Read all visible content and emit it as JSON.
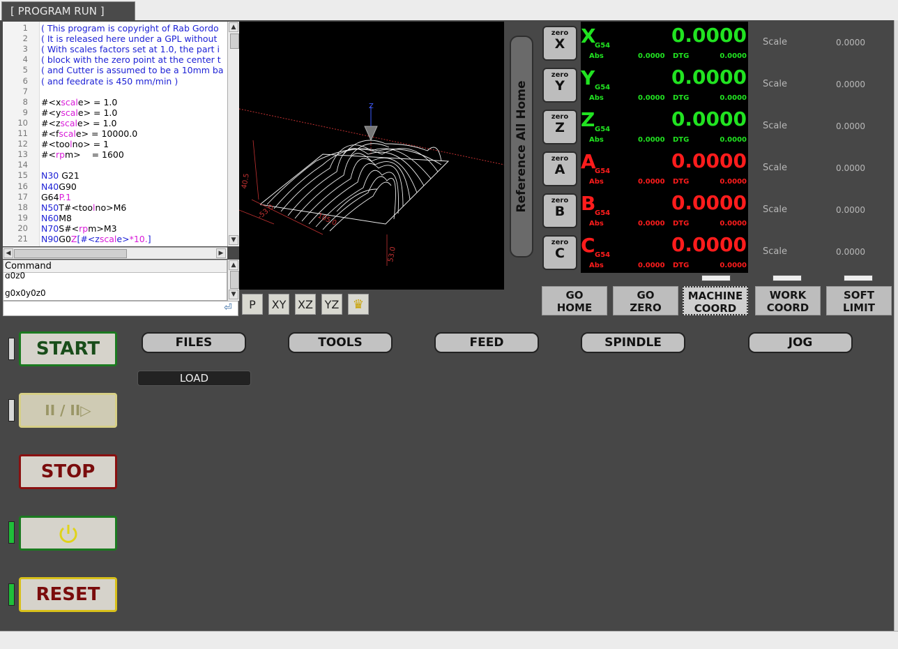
{
  "tab": {
    "label": "[ PROGRAM RUN ]"
  },
  "gcode": {
    "lines": [
      {
        "n": "1",
        "parts": [
          [
            "cm",
            "( This program is copyright of Rab Gordo"
          ]
        ]
      },
      {
        "n": "2",
        "parts": [
          [
            "cm",
            "( It is released here under a GPL without"
          ]
        ]
      },
      {
        "n": "3",
        "parts": [
          [
            "cm",
            "( With scales factors set at 1.0, the part i"
          ]
        ]
      },
      {
        "n": "4",
        "parts": [
          [
            "cm",
            "( block with the zero point at the center t"
          ]
        ]
      },
      {
        "n": "5",
        "parts": [
          [
            "cm",
            "( and Cutter is assumed to be a 10mm ba"
          ]
        ]
      },
      {
        "n": "6",
        "parts": [
          [
            "cm",
            "( and feedrate is 450 mm/min )"
          ]
        ]
      },
      {
        "n": "7",
        "parts": []
      },
      {
        "n": "8",
        "parts": [
          [
            "tx",
            "#<x"
          ],
          [
            "vr",
            "scal"
          ],
          [
            "tx",
            "e> = 1.0"
          ]
        ]
      },
      {
        "n": "9",
        "parts": [
          [
            "tx",
            "#<y"
          ],
          [
            "vr",
            "scal"
          ],
          [
            "tx",
            "e> = 1.0"
          ]
        ]
      },
      {
        "n": "10",
        "parts": [
          [
            "tx",
            "#<z"
          ],
          [
            "vr",
            "scal"
          ],
          [
            "tx",
            "e> = 1.0"
          ]
        ]
      },
      {
        "n": "11",
        "parts": [
          [
            "tx",
            "#<f"
          ],
          [
            "vr",
            "scal"
          ],
          [
            "tx",
            "e> = 10000.0"
          ]
        ]
      },
      {
        "n": "12",
        "parts": [
          [
            "tx",
            "#<too"
          ],
          [
            "vr",
            "l"
          ],
          [
            "tx",
            "no> = 1"
          ]
        ]
      },
      {
        "n": "13",
        "parts": [
          [
            "tx",
            "#<"
          ],
          [
            "vr",
            "rp"
          ],
          [
            "tx",
            "m>    = 1600"
          ]
        ]
      },
      {
        "n": "14",
        "parts": []
      },
      {
        "n": "15",
        "parts": [
          [
            "nb",
            "N30"
          ],
          [
            "tx",
            " G21"
          ]
        ]
      },
      {
        "n": "16",
        "parts": [
          [
            "nb",
            "N40"
          ],
          [
            "tx",
            "G90"
          ]
        ]
      },
      {
        "n": "17",
        "parts": [
          [
            "tx",
            "G64"
          ],
          [
            "pm",
            "P.1"
          ]
        ]
      },
      {
        "n": "18",
        "parts": [
          [
            "nb",
            "N50"
          ],
          [
            "tx",
            "T#<too"
          ],
          [
            "vr",
            "l"
          ],
          [
            "tx",
            "no>M6"
          ]
        ]
      },
      {
        "n": "19",
        "parts": [
          [
            "nb",
            "N60"
          ],
          [
            "tx",
            "M8"
          ]
        ]
      },
      {
        "n": "20",
        "parts": [
          [
            "nb",
            "N70"
          ],
          [
            "tx",
            "S#<"
          ],
          [
            "vr",
            "rp"
          ],
          [
            "tx",
            "m>M3"
          ]
        ]
      },
      {
        "n": "21",
        "parts": [
          [
            "nb",
            "N90"
          ],
          [
            "tx",
            "G0"
          ],
          [
            "pm",
            "Z"
          ],
          [
            "nb",
            "[#<z"
          ],
          [
            "vr",
            "scal"
          ],
          [
            "nb",
            "e>"
          ],
          [
            "pm",
            "*10."
          ],
          [
            "nb",
            "]"
          ]
        ]
      }
    ]
  },
  "command": {
    "header": "Command",
    "history": [
      "g0z0",
      "g0x0y0z0"
    ],
    "input_value": ""
  },
  "preview": {
    "view_buttons": [
      "P",
      "XY",
      "XZ",
      "YZ"
    ],
    "dims": {
      "x": "105.0",
      "y": "40.5",
      "y2": "16.5",
      "neg": "-53.0",
      "z": "53.0",
      "neg2": "-56"
    },
    "axis_label": "Z"
  },
  "reference_all_home": "Reference All Home",
  "zero_label": "zero",
  "axes": [
    {
      "axis": "X",
      "system": "G54",
      "value": "0.0000",
      "abs_label": "Abs",
      "abs": "0.0000",
      "dtg_label": "DTG",
      "dtg": "0.0000",
      "color": "#21e321",
      "scale_label": "Scale",
      "scale": "0.0000"
    },
    {
      "axis": "Y",
      "system": "G54",
      "value": "0.0000",
      "abs_label": "Abs",
      "abs": "0.0000",
      "dtg_label": "DTG",
      "dtg": "0.0000",
      "color": "#21e321",
      "scale_label": "Scale",
      "scale": "0.0000"
    },
    {
      "axis": "Z",
      "system": "G54",
      "value": "0.0000",
      "abs_label": "Abs",
      "abs": "0.0000",
      "dtg_label": "DTG",
      "dtg": "0.0000",
      "color": "#21e321",
      "scale_label": "Scale",
      "scale": "0.0000"
    },
    {
      "axis": "A",
      "system": "G54",
      "value": "0.0000",
      "abs_label": "Abs",
      "abs": "0.0000",
      "dtg_label": "DTG",
      "dtg": "0.0000",
      "color": "#ff1c1c",
      "scale_label": "Scale",
      "scale": "0.0000"
    },
    {
      "axis": "B",
      "system": "G54",
      "value": "0.0000",
      "abs_label": "Abs",
      "abs": "0.0000",
      "dtg_label": "DTG",
      "dtg": "0.0000",
      "color": "#ff1c1c",
      "scale_label": "Scale",
      "scale": "0.0000"
    },
    {
      "axis": "C",
      "system": "G54",
      "value": "0.0000",
      "abs_label": "Abs",
      "abs": "0.0000",
      "dtg_label": "DTG",
      "dtg": "0.0000",
      "color": "#ff1c1c",
      "scale_label": "Scale",
      "scale": "0.0000"
    }
  ],
  "go_buttons": {
    "go_home": [
      "GO",
      "HOME"
    ],
    "go_zero": [
      "GO",
      "ZERO"
    ],
    "machine_coord": [
      "MACHINE",
      "COORD"
    ],
    "work_coord": [
      "WORK",
      "COORD"
    ],
    "soft_limit": [
      "SOFT",
      "LIMIT"
    ]
  },
  "controls": {
    "start": "START",
    "pause_resume": "II / II▷",
    "stop": "STOP",
    "reset": "RESET"
  },
  "menu": {
    "files": "FILES",
    "tools": "TOOLS",
    "feed": "FEED",
    "spindle": "SPINDLE",
    "jog": "JOG",
    "load": "LOAD"
  },
  "colors": {
    "green_led": "#1fbf3a",
    "start_border": "#1b7a20",
    "stop_border": "#8a1010",
    "reset_border": "#d8c01a"
  }
}
